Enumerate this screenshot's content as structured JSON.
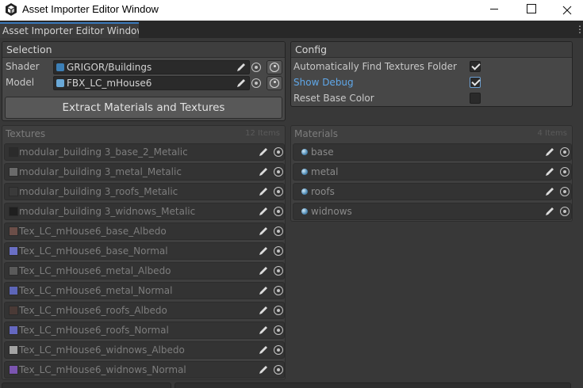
{
  "window": {
    "title": "Asset Importer Editor Window",
    "app_icon": "unity-icon",
    "controls": [
      "minimize-icon",
      "maximize-icon",
      "close-icon"
    ]
  },
  "tab": {
    "label": "Asset Importer Editor Window",
    "menu_icon": "kebab-menu-icon"
  },
  "selection": {
    "header": "Selection",
    "shader_label": "Shader",
    "shader_value": "GRIGOR/Buildings",
    "model_label": "Model",
    "model_value": "FBX_LC_mHouse6",
    "extract_button": "Extract Materials and Textures"
  },
  "config": {
    "header": "Config",
    "options": [
      {
        "label": "Automatically Find Textures Folder",
        "checked": true
      },
      {
        "label": "Show Debug",
        "checked": true
      },
      {
        "label": "Reset Base Color",
        "checked": false
      }
    ]
  },
  "textures": {
    "title": "Textures",
    "count": "12 Items",
    "items": [
      {
        "name": "modular_building 3_base_2_Metalic",
        "color": "#2b2b2b"
      },
      {
        "name": "modular_building 3_metal_Metalic",
        "color": "#6a6a6a"
      },
      {
        "name": "modular_building 3_roofs_Metalic",
        "color": "#3a3a3a"
      },
      {
        "name": "modular_building 3_widnows_Metalic",
        "color": "#1f1f1f"
      },
      {
        "name": "Tex_LC_mHouse6_base_Albedo",
        "color": "#6b4e48"
      },
      {
        "name": "Tex_LC_mHouse6_base_Normal",
        "color": "#6a6fc4"
      },
      {
        "name": "Tex_LC_mHouse6_metal_Albedo",
        "color": "#5a5a5a"
      },
      {
        "name": "Tex_LC_mHouse6_metal_Normal",
        "color": "#5d66b8"
      },
      {
        "name": "Tex_LC_mHouse6_roofs_Albedo",
        "color": "#4a3a36"
      },
      {
        "name": "Tex_LC_mHouse6_roofs_Normal",
        "color": "#6568c0"
      },
      {
        "name": "Tex_LC_mHouse6_widnows_Albedo",
        "color": "#a3a3a3"
      },
      {
        "name": "Tex_LC_mHouse6_widnows_Normal",
        "color": "#7b55b0"
      }
    ]
  },
  "materials": {
    "title": "Materials",
    "count": "4 Items",
    "items": [
      {
        "name": "base"
      },
      {
        "name": "metal"
      },
      {
        "name": "roofs"
      },
      {
        "name": "widnows"
      }
    ]
  },
  "colors": {
    "accent": "#3a79bb",
    "link": "#5fa7e8",
    "background": "#383838"
  }
}
